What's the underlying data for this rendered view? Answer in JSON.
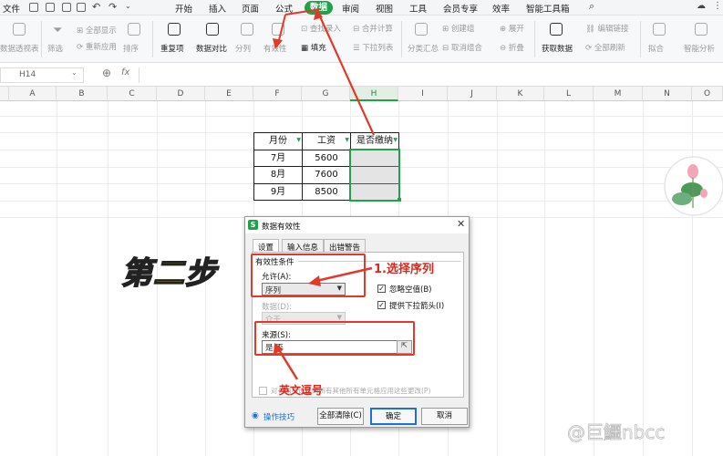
{
  "menu": {
    "file": "文件",
    "items": [
      "开始",
      "插入",
      "页面",
      "公式",
      "数据",
      "审阅",
      "视图",
      "工具",
      "会员专享",
      "效率",
      "智能工具箱"
    ],
    "active": "数据"
  },
  "ribbon": {
    "pivot": "数据透视表",
    "filter": "筛选",
    "show_all": "全部显示",
    "reapply": "重新应用",
    "sort": "排序",
    "duplicates": "重复项",
    "compare": "数据对比",
    "split": "分列",
    "validity": "有效性",
    "fill": "填充",
    "find_entry": "查找录入",
    "dropdown": "下拉列表",
    "merge_calc": "合并计算",
    "group_display": "分类汇总",
    "create_group": "创建组",
    "ungroup": "取消组合",
    "expand": "展开",
    "collapse": "折叠",
    "get_data": "获取数据",
    "edit_link": "编辑链接",
    "refresh_all": "全部刷新",
    "simulate": "拟合",
    "smart_analysis": "智能分析"
  },
  "formula_bar": {
    "name_box": "H14",
    "fx": "fx"
  },
  "columns": [
    "A",
    "B",
    "C",
    "D",
    "E",
    "F",
    "G",
    "H",
    "I",
    "J",
    "K",
    "L",
    "M",
    "N",
    "O"
  ],
  "selected_column": "H",
  "table": {
    "headers": [
      "月份",
      "工资",
      "是否缴纳"
    ],
    "rows": [
      [
        "7月",
        "5600",
        ""
      ],
      [
        "8月",
        "7600",
        ""
      ],
      [
        "9月",
        "8500",
        ""
      ]
    ]
  },
  "dialog": {
    "title": "数据有效性",
    "tabs": [
      "设置",
      "输入信息",
      "出错警告"
    ],
    "active_tab": "设置",
    "section": "有效性条件",
    "allow_label": "允许(A):",
    "allow_value": "序列",
    "data_label": "数据(D):",
    "data_value": "介于",
    "ignore_blank": "忽略空值(B)",
    "dropdown_arrow": "提供下拉箭头(I)",
    "source_label": "来源(S):",
    "source_value": "是,否",
    "apply_all": "对有同样设置的所有其他所有单元格应用这些更改(P)",
    "tips": "操作技巧",
    "clear_all": "全部清除(C)",
    "ok": "确定",
    "cancel": "取消"
  },
  "annotations": {
    "select_sequence": "1.选择序列",
    "comma": "英文逗号",
    "step": "第二步"
  },
  "watermark": "@巨鱷nbcc",
  "colors": {
    "accent": "#1fa24a",
    "annotation": "#e23a2a",
    "step_text": "#f8e020"
  }
}
